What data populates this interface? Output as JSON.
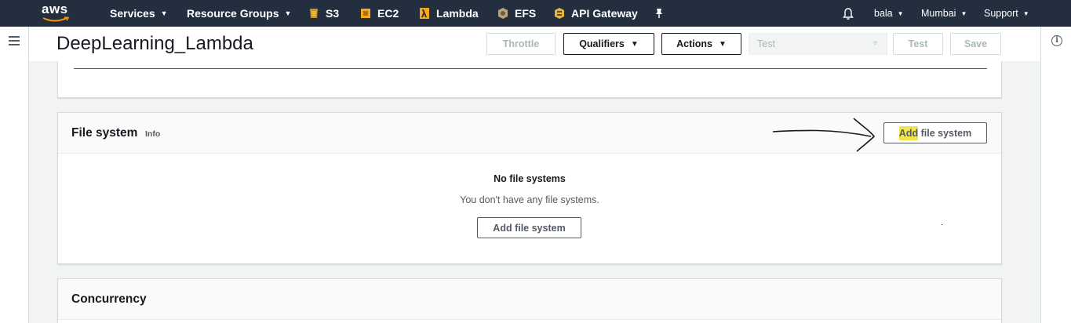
{
  "topnav": {
    "logo": "aws",
    "services": "Services",
    "resource_groups": "Resource Groups",
    "favorites": [
      {
        "label": "S3",
        "icon": "s3-icon",
        "color": "#e7b53a"
      },
      {
        "label": "EC2",
        "icon": "ec2-icon",
        "color": "#f7a81b"
      },
      {
        "label": "Lambda",
        "icon": "lambda-icon",
        "color": "#f7a81b"
      },
      {
        "label": "EFS",
        "icon": "efs-icon",
        "color": "#b9a37c"
      },
      {
        "label": "API Gateway",
        "icon": "api-gateway-icon",
        "color": "#e7b53a"
      }
    ],
    "pin_icon": "pin-icon",
    "bell_icon": "bell-icon",
    "user": "bala",
    "region": "Mumbai",
    "support": "Support"
  },
  "header": {
    "title": "DeepLearning_Lambda",
    "throttle": "Throttle",
    "qualifiers": "Qualifiers",
    "actions": "Actions",
    "test_select": "Test",
    "test_button": "Test",
    "save_button": "Save"
  },
  "file_system": {
    "title": "File system",
    "info": "Info",
    "add_button_highlight": "Add",
    "add_button_rest": " file system",
    "empty_title": "No file systems",
    "empty_desc": "You don't have any file systems.",
    "empty_add_button": "Add file system"
  },
  "concurrency": {
    "title": "Concurrency"
  },
  "colors": {
    "nav_bg": "#232f3e",
    "highlight": "#f0e54d",
    "page_bg": "#f2f3f3"
  }
}
